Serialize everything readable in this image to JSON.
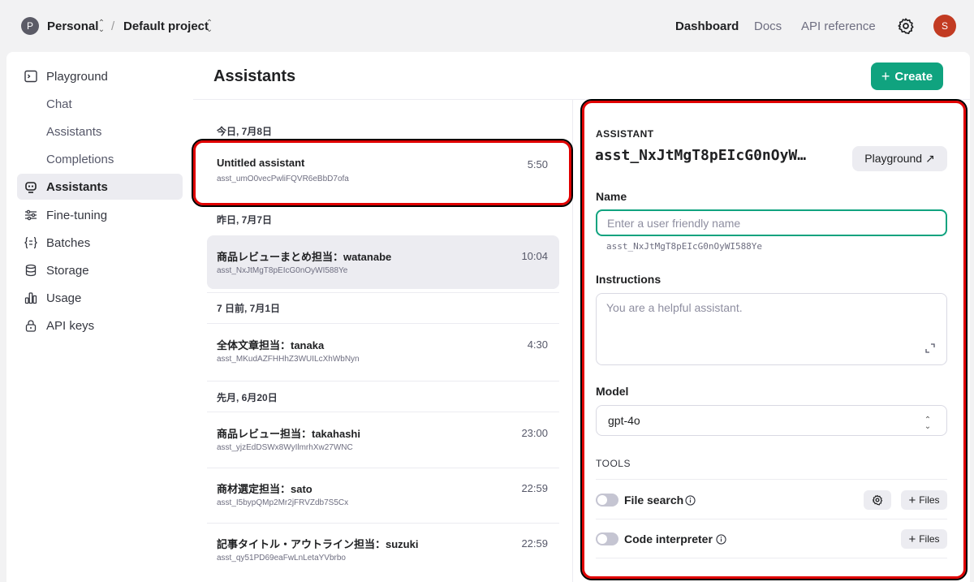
{
  "topbar": {
    "org_initial": "P",
    "org_name": "Personal",
    "separator": "/",
    "project_name": "Default project",
    "nav": [
      "Dashboard",
      "Docs",
      "API reference"
    ],
    "user_initial": "S"
  },
  "sidebar": {
    "playground": "Playground",
    "playground_sub": [
      "Chat",
      "Assistants",
      "Completions"
    ],
    "items": [
      "Assistants",
      "Fine-tuning",
      "Batches",
      "Storage",
      "Usage",
      "API keys"
    ]
  },
  "page": {
    "title": "Assistants",
    "create_label": "Create"
  },
  "groups": [
    "今日, 7月8日",
    "昨日, 7月7日",
    "7 日前, 7月1日",
    "先月, 6月20日"
  ],
  "assistants": [
    {
      "name": "Untitled assistant",
      "id": "asst_umO0vecPwliFQVR6eBbD7ofa",
      "time": "5:50"
    },
    {
      "name": "商品レビューまとめ担当：watanabe",
      "id": "asst_NxJtMgT8pEIcG0nOyWI588Ye",
      "time": "10:04"
    },
    {
      "name": "全体文章担当：tanaka",
      "id": "asst_MKudAZFHHhZ3WUILcXhWbNyn",
      "time": "4:30"
    },
    {
      "name": "商品レビュー担当：takahashi",
      "id": "asst_yjzEdDSWx8WyIlmrhXw27WNC",
      "time": "23:00"
    },
    {
      "name": "商材選定担当：sato",
      "id": "asst_I5bypQMp2Mr2jFRVZdb7S5Cx",
      "time": "22:59"
    },
    {
      "name": "記事タイトル・アウトライン担当：suzuki",
      "id": "asst_qy51PD69eaFwLnLetaYVbrbo",
      "time": "22:59"
    }
  ],
  "detail": {
    "section_label": "ASSISTANT",
    "assistant_id": "asst_NxJtMgT8pEIcG0nOyW…",
    "playground_label": "Playground ↗",
    "name_label": "Name",
    "name_placeholder": "Enter a user friendly name",
    "name_id": "asst_NxJtMgT8pEIcG0nOyWI588Ye",
    "instructions_label": "Instructions",
    "instructions_placeholder": "You are a helpful assistant.",
    "model_label": "Model",
    "model_value": "gpt-4o",
    "tools_label": "TOOLS",
    "tools": [
      {
        "name": "File search",
        "files_label": "Files"
      },
      {
        "name": "Code interpreter",
        "files_label": "Files"
      }
    ]
  }
}
